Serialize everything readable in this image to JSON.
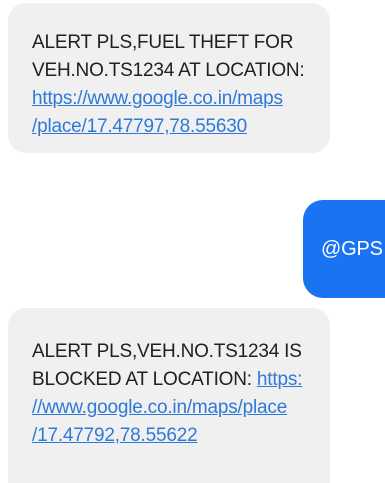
{
  "messages": [
    {
      "direction": "incoming",
      "lines": [
        "ALERT PLS,FUEL THEFT FOR",
        "VEH.NO.TS1234 AT LOCATION:"
      ],
      "link_lines": [
        "https://www.google.co.in/maps",
        "/place/17.47797,78.55630"
      ]
    },
    {
      "direction": "outgoing",
      "text": "@GPS"
    },
    {
      "direction": "incoming",
      "lines": [
        "ALERT PLS,VEH.NO.TS1234 IS",
        "BLOCKED AT LOCATION: "
      ],
      "link_inline": "https:",
      "link_lines": [
        "//www.google.co.in/maps/place",
        "/17.47792,78.55622"
      ]
    }
  ],
  "colors": {
    "incoming_bubble": "#f0f0f0",
    "outgoing_bubble": "#1a73f0",
    "link": "#2f79d6",
    "text": "#202020"
  }
}
